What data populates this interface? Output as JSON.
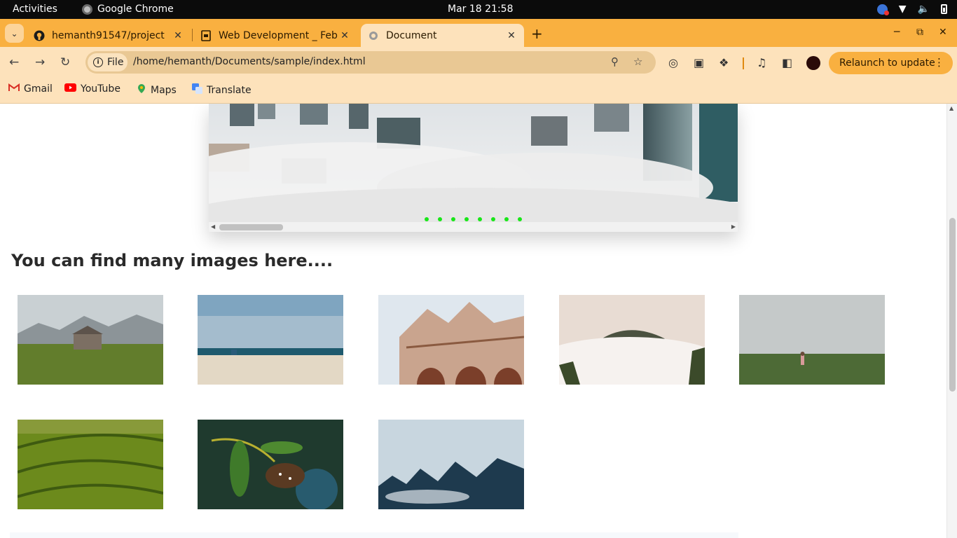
{
  "system": {
    "activities": "Activities",
    "app_name": "Google Chrome",
    "clock": "Mar 18  21:58"
  },
  "tabs": [
    {
      "title": "hemanth91547/project",
      "icon": "github-icon"
    },
    {
      "title": "Web Development _ Feb",
      "icon": "slides-icon"
    },
    {
      "title": "Document",
      "icon": "globe-icon",
      "active": true
    }
  ],
  "toolbar": {
    "scheme_label": "File",
    "url": "/home/hemanth/Documents/sample/index.html",
    "relaunch_label": "Relaunch to update"
  },
  "bookmarks": [
    {
      "label": "Gmail",
      "color": "#d93025"
    },
    {
      "label": "YouTube",
      "color": "#ff0000"
    },
    {
      "label": "Maps",
      "color": "#34a853"
    },
    {
      "label": "Translate",
      "color": "#4285f4"
    }
  ],
  "page": {
    "heading": "You can find many images here....",
    "slider_dot_count": 8,
    "slider_dot_color": "#19e619",
    "gallery": [
      {
        "subject": "mountain meadow with cabin"
      },
      {
        "subject": "beach and sea"
      },
      {
        "subject": "cathedral facade"
      },
      {
        "subject": "hill above clouds"
      },
      {
        "subject": "girl in green field"
      },
      {
        "subject": "green wavy field"
      },
      {
        "subject": "butterfly on leaves"
      },
      {
        "subject": "misty forest"
      }
    ]
  }
}
